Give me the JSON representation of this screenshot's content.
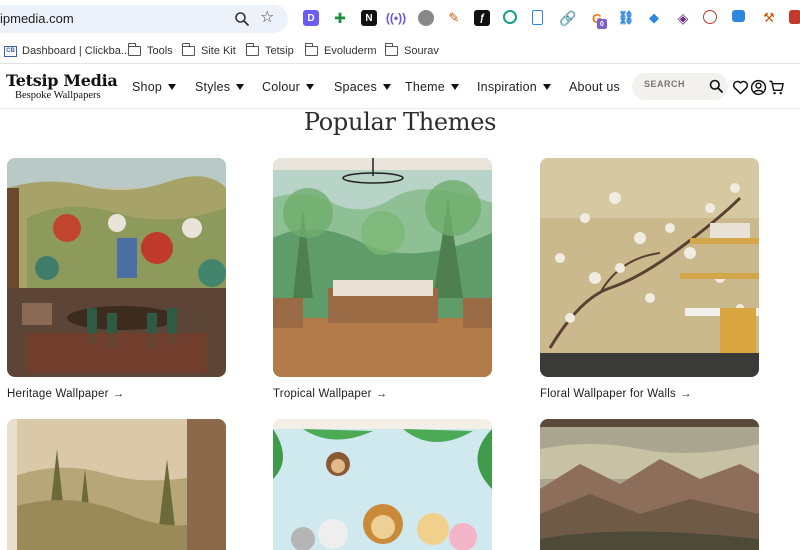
{
  "browser": {
    "url": "ipmedia.com",
    "extension_badge": "0",
    "bookmarks": [
      {
        "label": "Dashboard | Clickba..."
      },
      {
        "label": "Tools"
      },
      {
        "label": "Site Kit"
      },
      {
        "label": "Tetsip"
      },
      {
        "label": "Evoluderm"
      },
      {
        "label": "Sourav"
      }
    ]
  },
  "site": {
    "brand": "Tetsip Media",
    "tagline": "Bespoke Wallpapers",
    "nav": [
      {
        "label": "Shop"
      },
      {
        "label": "Styles"
      },
      {
        "label": "Colour"
      },
      {
        "label": "Spaces"
      },
      {
        "label": "Theme"
      },
      {
        "label": "Inspiration"
      },
      {
        "label": "About us"
      }
    ],
    "search_placeholder": "SEARCH"
  },
  "main": {
    "title": "Popular Themes",
    "themes": [
      {
        "label": "Heritage Wallpaper",
        "arrow": "→"
      },
      {
        "label": "Tropical Wallpaper",
        "arrow": "→"
      },
      {
        "label": "Floral Wallpaper for Walls",
        "arrow": "→"
      }
    ]
  },
  "colors": {
    "omnibox": "#edf2fa",
    "search_bg": "#f3f1ee",
    "text": "#222222"
  }
}
